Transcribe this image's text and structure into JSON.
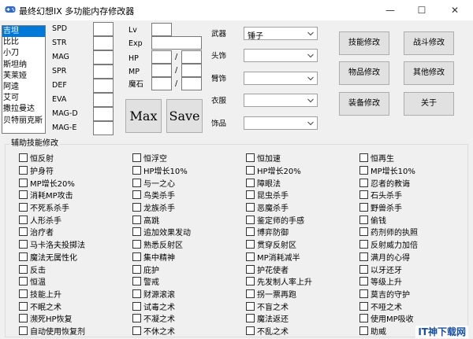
{
  "window": {
    "title": "最终幻想IX 多功能内存修改器",
    "minimize": "—",
    "maximize": "☐",
    "close": "✕"
  },
  "characters": {
    "items": [
      "吉坦",
      "比比",
      "小刀",
      "斯坦纳",
      "芙莱娅",
      "阿逵",
      "艾可",
      "撒拉曼达",
      "贝特丽克斯"
    ],
    "selected_index": 0
  },
  "stats": {
    "labels": [
      "SPD",
      "STR",
      "MAG",
      "SPR",
      "DEF",
      "EVA",
      "MAG-D",
      "MAG-E"
    ]
  },
  "level": {
    "lv": "Lv",
    "exp": "Exp",
    "hp": "HP",
    "mp": "MP",
    "magic_stone": "魔石",
    "slash": "/"
  },
  "buttons": {
    "max": "Max",
    "save": "Save",
    "skill_edit": "技能修改",
    "battle_edit": "战斗修改",
    "item_edit": "物品修改",
    "other_edit": "其他修改",
    "equip_edit": "装备修改",
    "about": "关于"
  },
  "equipment": {
    "weapon_label": "武器",
    "weapon_value": "锤子",
    "head_label": "头饰",
    "arm_label": "臂饰",
    "body_label": "衣服",
    "accessory_label": "饰品"
  },
  "support_skills": {
    "title": "辅助技能修改",
    "col1": [
      "恒反射",
      "护身符",
      "MP增长20%",
      "消耗MP攻击",
      "不死系杀手",
      "人形杀手",
      "治疗者",
      "马卡洛夫投掷法",
      "魔法无属性化",
      "反击",
      "恒温",
      "技能上升",
      "不眠之术",
      "濒死HP恢复",
      "自动使用恢复剂",
      "斩铁伤害"
    ],
    "col2": [
      "恒浮空",
      "HP增长10%",
      "与一之心",
      "鸟类杀手",
      "龙族杀手",
      "高跳",
      "追加效果发动",
      "熟悉反射区",
      "集中精神",
      "庇护",
      "警戒",
      "财源滚滚",
      "试毒之术",
      "不凝之术",
      "不休之术",
      "抢劫"
    ],
    "col3": [
      "恒加速",
      "HP增长20%",
      "障眼法",
      "昆虫杀手",
      "恶魔杀手",
      "鉴定师的手感",
      "博弈防御",
      "贯穿反射区",
      "MP消耗减半",
      "护花使者",
      "先发制人率上升",
      "拐一票再跑",
      "不盲之术",
      "魔法返还",
      "不乱之术",
      "盗贼的技能"
    ],
    "col4": [
      "恒再生",
      "MP增长10%",
      "忍者的教诲",
      "石头杀手",
      "野兽杀手",
      "偷钱",
      "药剂师的执照",
      "反射威力加倍",
      "满月的心得",
      "以牙还牙",
      "等级上升",
      "莫吉的守护",
      "不哑之术",
      "使用MP吸收",
      "助威",
      "满月的心得"
    ]
  },
  "watermark": "IT神下载网"
}
